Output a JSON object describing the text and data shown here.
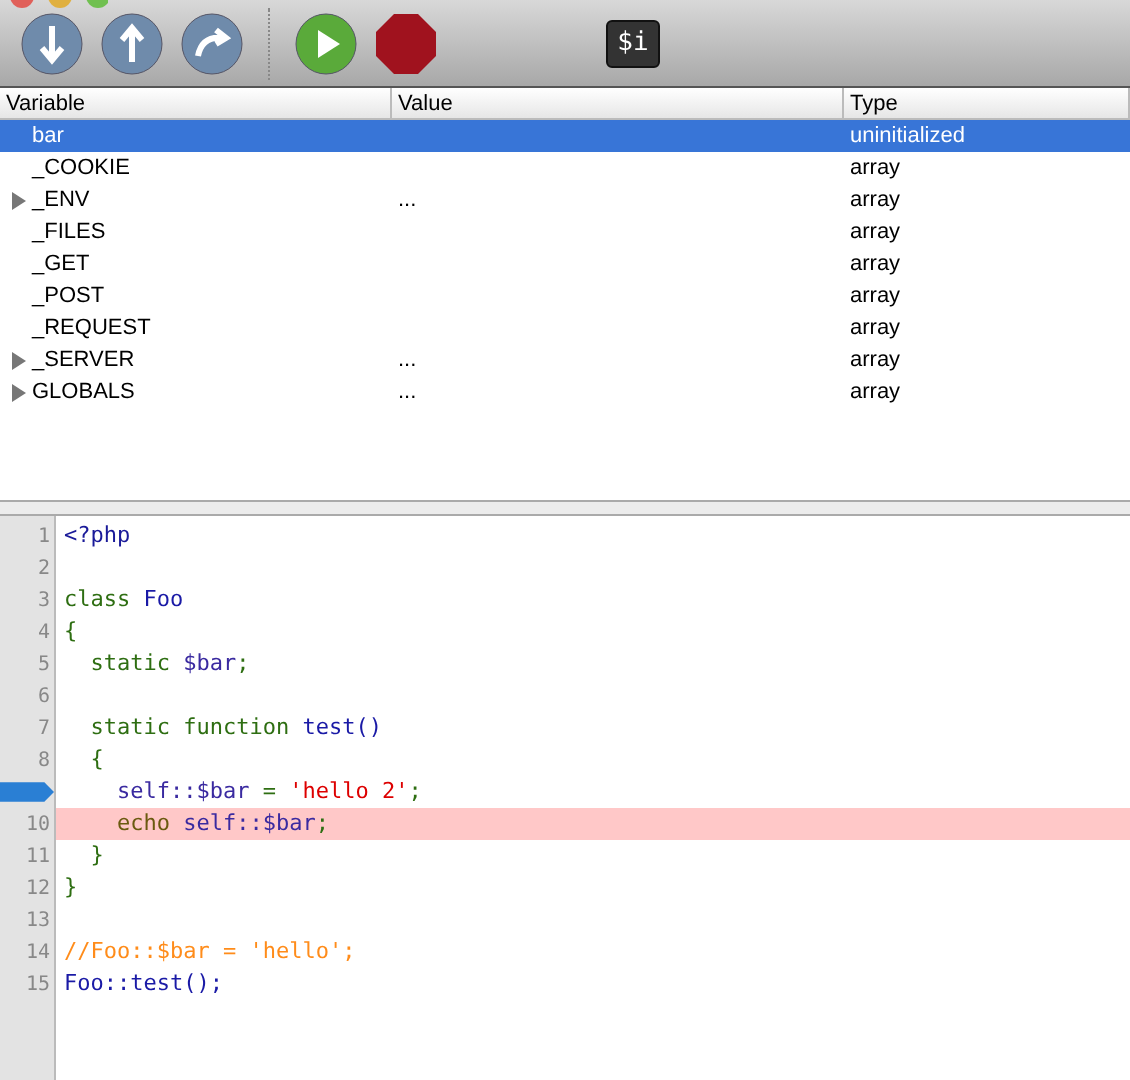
{
  "toolbar": {
    "buttons": [
      {
        "kind": "step-into"
      },
      {
        "kind": "step-out"
      },
      {
        "kind": "step-over"
      },
      {
        "kind": "separator"
      },
      {
        "kind": "run"
      },
      {
        "kind": "stop"
      }
    ],
    "console_label": "$i"
  },
  "variables": {
    "columns": [
      "Variable",
      "Value",
      "Type"
    ],
    "rows": [
      {
        "name": "bar",
        "value": "",
        "type": "uninitialized",
        "expandable": false,
        "selected": true
      },
      {
        "name": "_COOKIE",
        "value": "",
        "type": "array",
        "expandable": false,
        "selected": false
      },
      {
        "name": "_ENV",
        "value": "...",
        "type": "array",
        "expandable": true,
        "selected": false
      },
      {
        "name": "_FILES",
        "value": "",
        "type": "array",
        "expandable": false,
        "selected": false
      },
      {
        "name": "_GET",
        "value": "",
        "type": "array",
        "expandable": false,
        "selected": false
      },
      {
        "name": "_POST",
        "value": "",
        "type": "array",
        "expandable": false,
        "selected": false
      },
      {
        "name": "_REQUEST",
        "value": "",
        "type": "array",
        "expandable": false,
        "selected": false
      },
      {
        "name": "_SERVER",
        "value": "...",
        "type": "array",
        "expandable": true,
        "selected": false
      },
      {
        "name": "GLOBALS",
        "value": "...",
        "type": "array",
        "expandable": true,
        "selected": false
      }
    ]
  },
  "editor": {
    "lines": [
      {
        "number": "1",
        "current": false,
        "highlighted": false,
        "tokens": [
          {
            "kind": "tag",
            "text": "<?php"
          }
        ]
      },
      {
        "number": "2",
        "current": false,
        "highlighted": false
      },
      {
        "number": "3",
        "current": false,
        "highlighted": false,
        "tokens": [
          {
            "kind": "keyword",
            "text": "class "
          },
          {
            "kind": "ident",
            "text": "Foo"
          }
        ]
      },
      {
        "number": "4",
        "current": false,
        "highlighted": false,
        "tokens": [
          {
            "kind": "punct",
            "text": "{"
          }
        ]
      },
      {
        "number": "5",
        "current": false,
        "highlighted": false,
        "tokens": [
          {
            "kind": "keyword",
            "text": "  static "
          },
          {
            "kind": "variable",
            "text": "$bar"
          },
          {
            "kind": "punct",
            "text": ";"
          }
        ]
      },
      {
        "number": "6",
        "current": false,
        "highlighted": false
      },
      {
        "number": "7",
        "current": false,
        "highlighted": false,
        "tokens": [
          {
            "kind": "keyword",
            "text": "  static function "
          },
          {
            "kind": "ident",
            "text": "test()"
          }
        ]
      },
      {
        "number": "8",
        "current": false,
        "highlighted": false,
        "tokens": [
          {
            "kind": "punct",
            "text": "  {"
          }
        ]
      },
      {
        "current": true,
        "highlighted": false,
        "tokens": [
          {
            "kind": "variable",
            "text": "    self::$bar "
          },
          {
            "kind": "punct",
            "text": "= "
          },
          {
            "kind": "string",
            "text": "'hello 2'"
          },
          {
            "kind": "punct",
            "text": ";"
          }
        ]
      },
      {
        "number": "10",
        "current": false,
        "highlighted": true,
        "tokens": [
          {
            "kind": "keyword",
            "text": "    echo "
          },
          {
            "kind": "variable",
            "text": "self::$bar"
          },
          {
            "kind": "punct",
            "text": ";"
          }
        ]
      },
      {
        "number": "11",
        "current": false,
        "highlighted": false,
        "tokens": [
          {
            "kind": "punct",
            "text": "  }"
          }
        ]
      },
      {
        "number": "12",
        "current": false,
        "highlighted": false,
        "tokens": [
          {
            "kind": "punct",
            "text": "}"
          }
        ]
      },
      {
        "number": "13",
        "current": false,
        "highlighted": false
      },
      {
        "number": "14",
        "current": false,
        "highlighted": false,
        "tokens": [
          {
            "kind": "comment",
            "text": "//Foo::$bar = 'hello';"
          }
        ]
      },
      {
        "number": "15",
        "current": false,
        "highlighted": false,
        "tokens": [
          {
            "kind": "ident",
            "text": "Foo::test();"
          }
        ]
      }
    ]
  }
}
